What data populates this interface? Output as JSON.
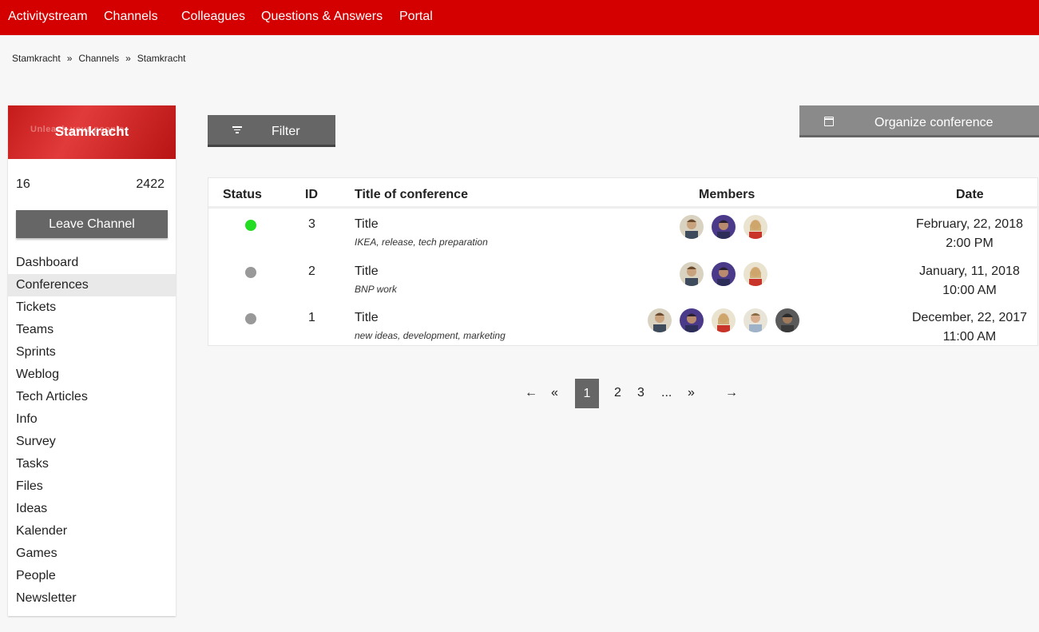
{
  "topnav": [
    "Activitystream",
    "Channels",
    "Colleagues",
    "Questions & Answers",
    "Portal"
  ],
  "breadcrumb": [
    "Stamkracht",
    "Channels",
    "Stamkracht"
  ],
  "breadcrumb_sep": "»",
  "channel": {
    "name": "Stamkracht",
    "banner_text": "Unleash your people",
    "stat_left": "16",
    "stat_right": "2422",
    "leave_label": "Leave Channel"
  },
  "menu": [
    "Dashboard",
    "Conferences",
    "Tickets",
    "Teams",
    "Sprints",
    "Weblog",
    "Tech Articles",
    "Info",
    "Survey",
    "Tasks",
    "Files",
    "Ideas",
    "Kalender",
    "Games",
    "People",
    "Newsletter"
  ],
  "active_menu": "Conferences",
  "filter_label": "Filter",
  "organize_label": "Organize conference",
  "table": {
    "headers": {
      "status": "Status",
      "id": "ID",
      "title": "Title of conference",
      "members": "Members",
      "date": "Date"
    },
    "rows": [
      {
        "status": "active",
        "id": "3",
        "title": "Title",
        "tags": "IKEA, release, tech preparation",
        "members": [
          "member-1",
          "member-2",
          "member-3"
        ],
        "date": "February, 22, 2018",
        "time": "2:00 PM"
      },
      {
        "status": "inactive",
        "id": "2",
        "title": "Title",
        "tags": "BNP work",
        "members": [
          "member-1",
          "member-2",
          "member-3"
        ],
        "date": "January, 11, 2018",
        "time": "10:00 AM"
      },
      {
        "status": "inactive",
        "id": "1",
        "title": "Title",
        "tags": "new ideas, development, marketing",
        "members": [
          "member-1",
          "member-2",
          "member-3",
          "member-4",
          "member-5"
        ],
        "date": "December, 22, 2017",
        "time": "11:00 AM"
      }
    ]
  },
  "pagination": {
    "first": "←",
    "prev": "«",
    "current": "1",
    "pages": [
      "2",
      "3"
    ],
    "ellipsis": "...",
    "next": "»",
    "last": "→"
  },
  "colors": {
    "brand": "#d40000",
    "active_dot": "#22dd22",
    "inactive_dot": "#999999",
    "button": "#666666"
  }
}
